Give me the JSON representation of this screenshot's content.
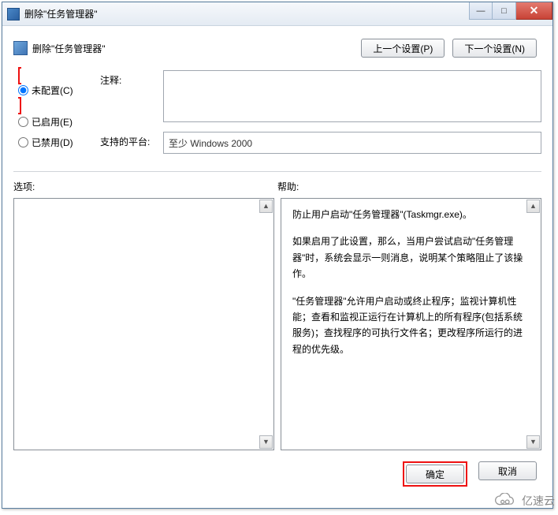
{
  "window": {
    "title": "删除\"任务管理器\"",
    "min_symbol": "—",
    "max_symbol": "□",
    "close_symbol": "✕"
  },
  "header": {
    "heading": "删除\"任务管理器\"",
    "prev_btn": "上一个设置(P)",
    "next_btn": "下一个设置(N)"
  },
  "radios": {
    "not_configured": "未配置(C)",
    "enabled": "已启用(E)",
    "disabled": "已禁用(D)"
  },
  "form": {
    "comment_label": "注释:",
    "comment_value": "",
    "platform_label": "支持的平台:",
    "platform_value": "至少 Windows 2000"
  },
  "sections": {
    "options_label": "选项:",
    "help_label": "帮助:"
  },
  "help": {
    "p1": "防止用户启动\"任务管理器\"(Taskmgr.exe)。",
    "p2": "如果启用了此设置，那么，当用户尝试启动\"任务管理器\"时，系统会显示一则消息，说明某个策略阻止了该操作。",
    "p3": "\"任务管理器\"允许用户启动或终止程序；监视计算机性能；查看和监视正运行在计算机上的所有程序(包括系统服务)；查找程序的可执行文件名；更改程序所运行的进程的优先级。"
  },
  "scroll": {
    "up": "▲",
    "down": "▼"
  },
  "footer": {
    "ok": "确定",
    "cancel": "取消"
  },
  "watermark": {
    "text": "亿速云"
  },
  "colors": {
    "highlight": "#e11"
  }
}
